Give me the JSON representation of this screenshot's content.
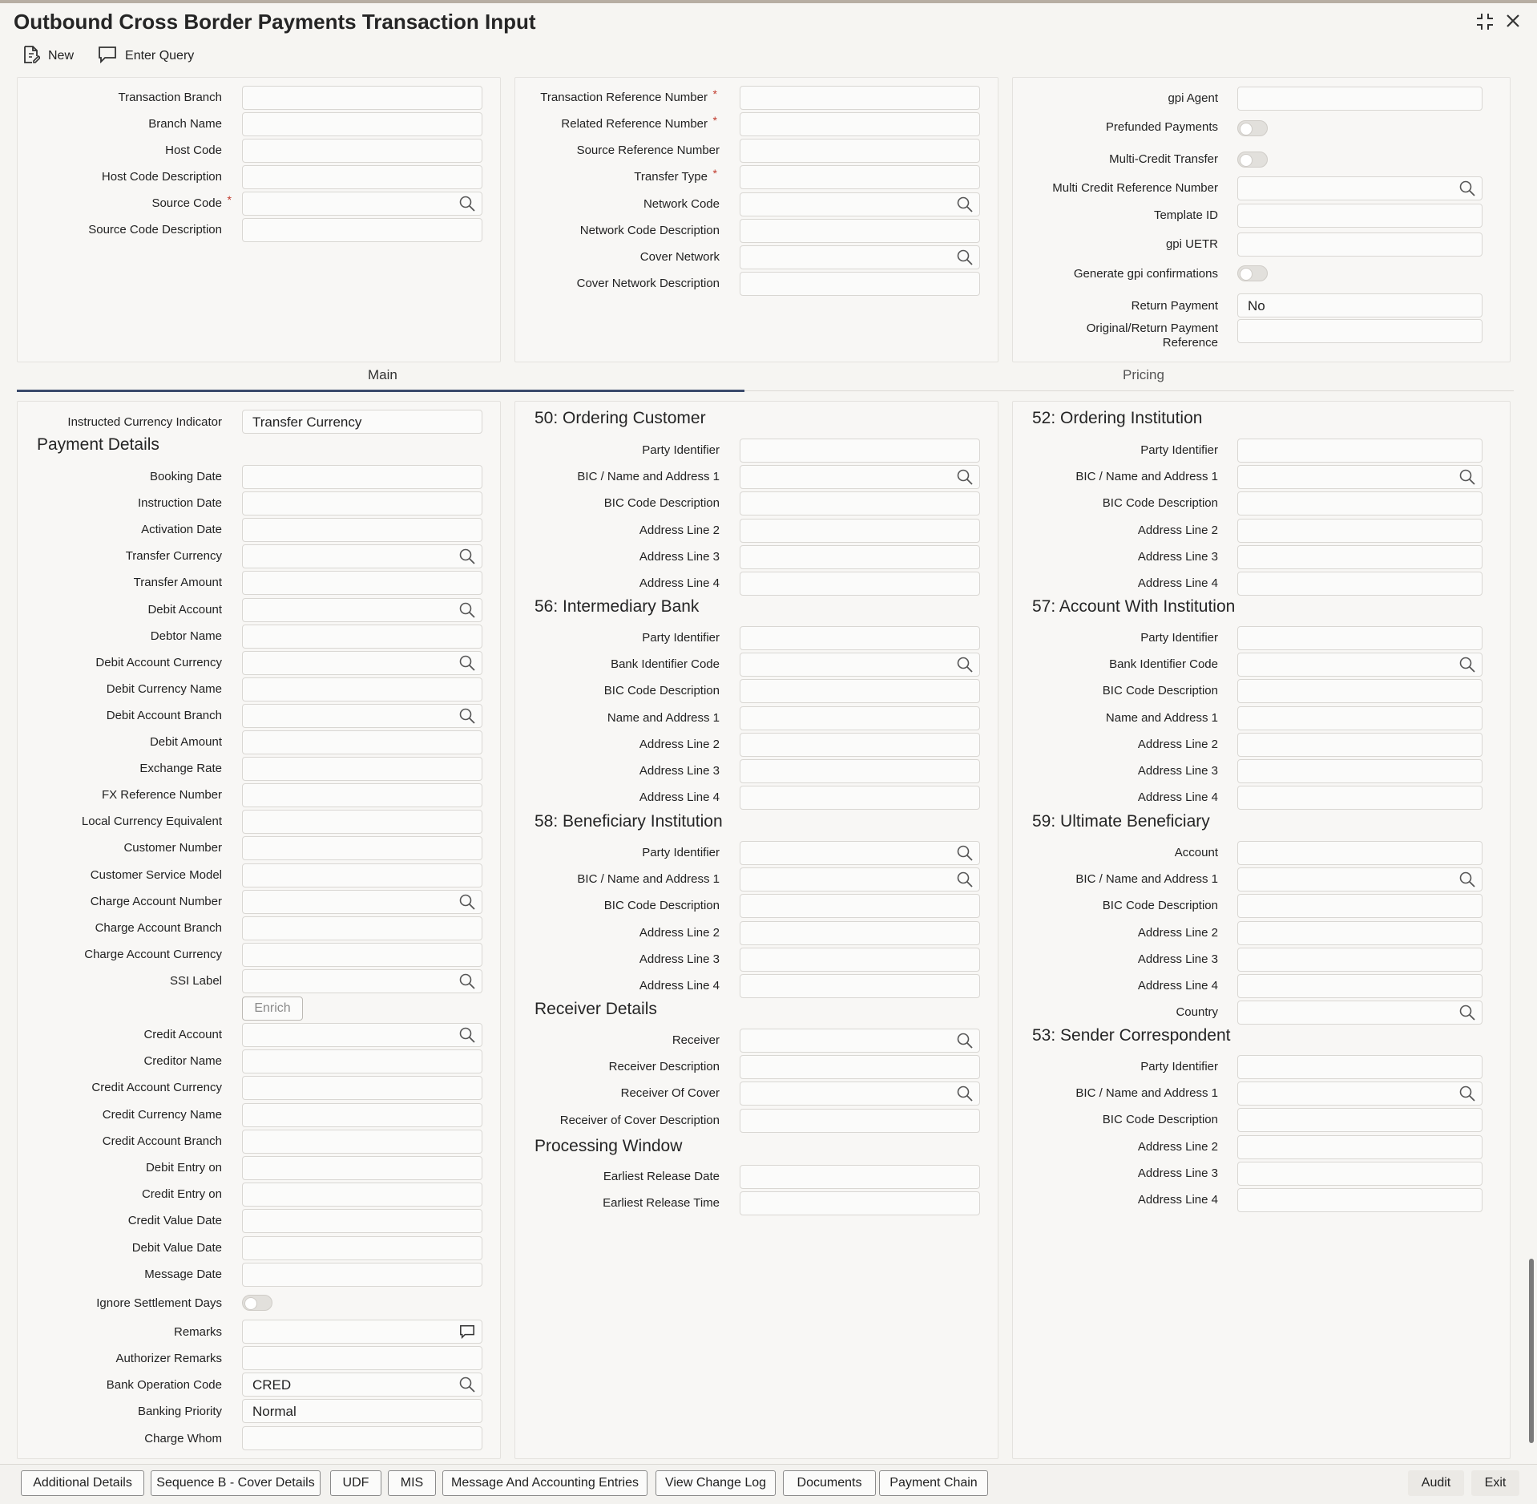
{
  "window": {
    "title": "Outbound Cross Border Payments Transaction Input"
  },
  "toolbar": {
    "new_label": "New",
    "query_label": "Enter Query"
  },
  "header_left": {
    "transaction_branch": "Transaction Branch",
    "branch_name": "Branch Name",
    "host_code": "Host Code",
    "host_code_description": "Host Code Description",
    "source_code": "Source Code",
    "source_code_description": "Source Code Description"
  },
  "header_mid": {
    "transaction_reference_number": "Transaction Reference Number",
    "related_reference_number": "Related Reference Number",
    "source_reference_number": "Source Reference Number",
    "transfer_type": "Transfer Type",
    "network_code": "Network Code",
    "network_code_description": "Network Code Description",
    "cover_network": "Cover Network",
    "cover_network_description": "Cover Network Description"
  },
  "header_right": {
    "gpi_agent": "gpi Agent",
    "prefunded_payments": "Prefunded Payments",
    "multi_credit_transfer": "Multi-Credit Transfer",
    "multi_credit_reference_number": "Multi Credit Reference Number",
    "template_id": "Template ID",
    "gpi_uetr": "gpi UETR",
    "generate_gpi_confirmations": "Generate gpi confirmations",
    "return_payment": "Return Payment",
    "return_payment_value": "No",
    "original_return_line1": "Original/Return Payment",
    "original_return_line2": "Reference"
  },
  "tabs": {
    "main": "Main",
    "pricing": "Pricing"
  },
  "payment": {
    "instructed_currency_indicator": "Instructed Currency Indicator",
    "instructed_currency_value": "Transfer Currency",
    "heading": "Payment Details",
    "labels": [
      "Booking Date",
      "Instruction Date",
      "Activation Date",
      "Transfer Currency",
      "Transfer Amount",
      "Debit Account",
      "Debtor Name",
      "Debit Account Currency",
      "Debit Currency Name",
      "Debit Account Branch",
      "Debit Amount",
      "Exchange Rate",
      "FX Reference Number",
      "Local Currency Equivalent",
      "Customer Number",
      "Customer Service Model",
      "Charge Account Number",
      "Charge Account Branch",
      "Charge Account Currency",
      "SSI Label"
    ],
    "enrich": "Enrich",
    "labels2": [
      "Credit Account",
      "Creditor Name",
      "Credit Account Currency",
      "Credit Currency Name",
      "Credit Account Branch",
      "Debit Entry on",
      "Credit Entry on",
      "Credit Value Date",
      "Debit Value Date",
      "Message Date"
    ],
    "ignore_settlement_days": "Ignore Settlement Days",
    "remarks": "Remarks",
    "authorizer_remarks": "Authorizer Remarks",
    "bank_operation_code": "Bank Operation Code",
    "bank_operation_code_value": "CRED",
    "banking_priority": "Banking Priority",
    "banking_priority_value": "Normal",
    "charge_whom": "Charge Whom"
  },
  "ordering_customer": {
    "heading": "50: Ordering Customer",
    "labels": [
      "Party Identifier",
      "BIC / Name and Address 1",
      "BIC Code Description",
      "Address Line 2",
      "Address Line 3",
      "Address Line 4"
    ]
  },
  "intermediary_bank": {
    "heading": "56: Intermediary Bank",
    "labels": [
      "Party Identifier",
      "Bank Identifier Code",
      "BIC Code Description",
      "Name and Address 1",
      "Address Line 2",
      "Address Line 3",
      "Address Line 4"
    ]
  },
  "beneficiary_institution": {
    "heading": "58: Beneficiary Institution",
    "labels": [
      "Party Identifier",
      "BIC / Name and Address 1",
      "BIC Code Description",
      "Address Line 2",
      "Address Line 3",
      "Address Line 4"
    ]
  },
  "receiver_details": {
    "heading": "Receiver Details",
    "labels": [
      "Receiver",
      "Receiver Description",
      "Receiver Of Cover",
      "Receiver of Cover Description"
    ]
  },
  "processing_window": {
    "heading": "Processing Window",
    "labels": [
      "Earliest Release Date",
      "Earliest Release Time"
    ]
  },
  "ordering_institution": {
    "heading": "52: Ordering Institution",
    "labels": [
      "Party Identifier",
      "BIC / Name and Address 1",
      "BIC Code Description",
      "Address Line 2",
      "Address Line 3",
      "Address Line 4"
    ]
  },
  "account_with_institution": {
    "heading": "57: Account With Institution",
    "labels": [
      "Party Identifier",
      "Bank Identifier Code",
      "BIC Code Description",
      "Name and Address 1",
      "Address Line 2",
      "Address Line 3",
      "Address Line 4"
    ]
  },
  "ultimate_beneficiary": {
    "heading": "59: Ultimate Beneficiary",
    "labels": [
      "Account",
      "BIC / Name and Address 1",
      "BIC Code Description",
      "Address Line 2",
      "Address Line 3",
      "Address Line 4",
      "Country"
    ]
  },
  "sender_correspondent": {
    "heading": "53: Sender Correspondent",
    "labels": [
      "Party Identifier",
      "BIC / Name and Address 1",
      "BIC Code Description",
      "Address Line 2",
      "Address Line 3",
      "Address Line 4"
    ]
  },
  "footer": {
    "buttons": [
      "Additional Details",
      "Sequence B - Cover Details",
      "UDF",
      "MIS",
      "Message And Accounting Entries",
      "View Change Log",
      "Documents",
      "Payment Chain"
    ],
    "audit": "Audit",
    "exit": "Exit"
  },
  "icons": {
    "search": "search-icon",
    "comment": "comment-icon",
    "new": "new-document-icon",
    "query": "enter-query-icon"
  }
}
